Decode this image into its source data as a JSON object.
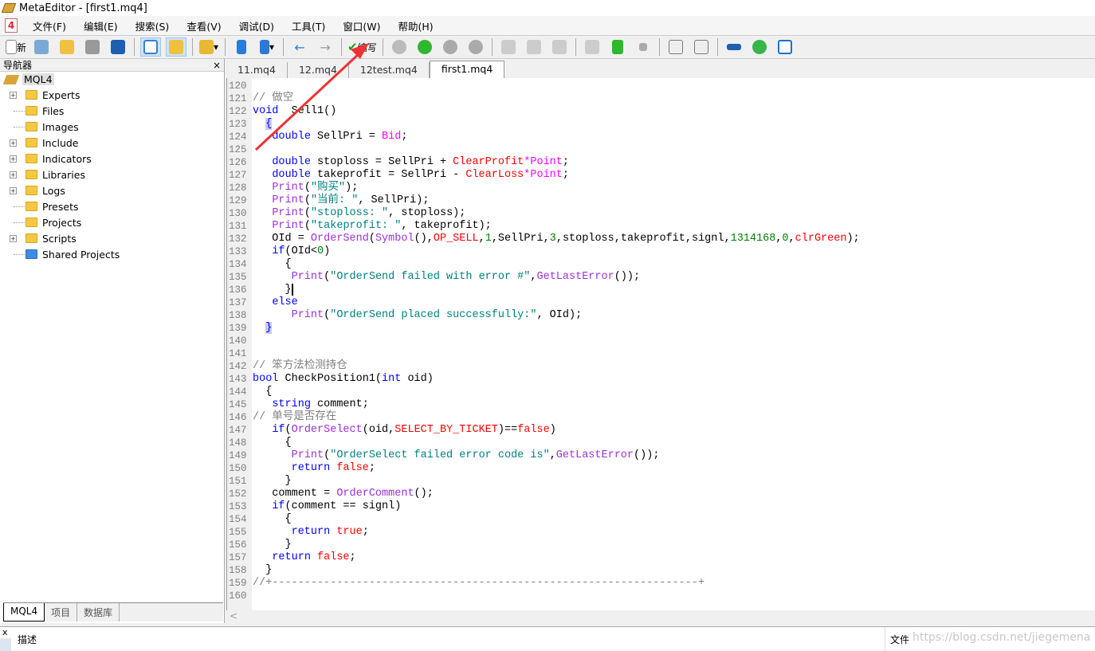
{
  "window": {
    "title": "MetaEditor - [first1.mq4]"
  },
  "menu": {
    "app_icon": "4",
    "items": [
      "文件(F)",
      "编辑(E)",
      "搜索(S)",
      "查看(V)",
      "调试(D)",
      "工具(T)",
      "窗口(W)",
      "帮助(H)"
    ]
  },
  "toolbar": {
    "new_label": "新",
    "compile_label": "编写"
  },
  "navigator": {
    "title": "导航器",
    "close": "×",
    "root": "MQL4",
    "items": [
      {
        "label": "Experts",
        "exp": true,
        "blue": false
      },
      {
        "label": "Files",
        "exp": false,
        "blue": false
      },
      {
        "label": "Images",
        "exp": false,
        "blue": false
      },
      {
        "label": "Include",
        "exp": true,
        "blue": false
      },
      {
        "label": "Indicators",
        "exp": true,
        "blue": false
      },
      {
        "label": "Libraries",
        "exp": true,
        "blue": false
      },
      {
        "label": "Logs",
        "exp": true,
        "blue": false
      },
      {
        "label": "Presets",
        "exp": false,
        "blue": false
      },
      {
        "label": "Projects",
        "exp": false,
        "blue": false
      },
      {
        "label": "Scripts",
        "exp": true,
        "blue": false
      },
      {
        "label": "Shared Projects",
        "exp": false,
        "blue": true
      }
    ],
    "bottom_tabs": [
      "MQL4",
      "项目",
      "数据库"
    ]
  },
  "editor": {
    "tabs": [
      "11.mq4",
      "12.mq4",
      "12test.mq4",
      "first1.mq4"
    ],
    "active_tab": 3,
    "scroll_left": "<",
    "lines": [
      {
        "n": "120",
        "t": []
      },
      {
        "n": "121",
        "t": [
          [
            "c",
            "// 做空"
          ]
        ]
      },
      {
        "n": "122",
        "t": [
          [
            "k",
            "void"
          ],
          [
            "",
            "  Sell1()"
          ]
        ]
      },
      {
        "n": "123",
        "t": [
          [
            "",
            "  "
          ],
          [
            "b",
            "{"
          ]
        ]
      },
      {
        "n": "124",
        "t": [
          [
            "",
            "   "
          ],
          [
            "k",
            "double"
          ],
          [
            "",
            " SellPri = "
          ],
          [
            "m",
            "Bid"
          ],
          [
            "",
            ";"
          ]
        ]
      },
      {
        "n": "125",
        "t": []
      },
      {
        "n": "126",
        "t": [
          [
            "",
            "   "
          ],
          [
            "k",
            "double"
          ],
          [
            "",
            " stoploss = SellPri + "
          ],
          [
            "r",
            "ClearProfit"
          ],
          [
            "m",
            "*Point"
          ],
          [
            "",
            ";"
          ]
        ]
      },
      {
        "n": "127",
        "t": [
          [
            "",
            "   "
          ],
          [
            "k",
            "double"
          ],
          [
            "",
            " takeprofit = SellPri - "
          ],
          [
            "r",
            "ClearLoss"
          ],
          [
            "m",
            "*Point"
          ],
          [
            "",
            ";"
          ]
        ]
      },
      {
        "n": "128",
        "t": [
          [
            "",
            "   "
          ],
          [
            "f",
            "Print"
          ],
          [
            "",
            "("
          ],
          [
            "s",
            "\"购买\""
          ],
          [
            "",
            ");"
          ]
        ]
      },
      {
        "n": "129",
        "t": [
          [
            "",
            "   "
          ],
          [
            "f",
            "Print"
          ],
          [
            "",
            "("
          ],
          [
            "s",
            "\"当前: \""
          ],
          [
            "",
            ", SellPri);"
          ]
        ]
      },
      {
        "n": "130",
        "t": [
          [
            "",
            "   "
          ],
          [
            "f",
            "Print"
          ],
          [
            "",
            "("
          ],
          [
            "s",
            "\"stoploss: \""
          ],
          [
            "",
            ", stoploss);"
          ]
        ]
      },
      {
        "n": "131",
        "t": [
          [
            "",
            "   "
          ],
          [
            "f",
            "Print"
          ],
          [
            "",
            "("
          ],
          [
            "s",
            "\"takeprofit: \""
          ],
          [
            "",
            ", takeprofit);"
          ]
        ]
      },
      {
        "n": "132",
        "t": [
          [
            "",
            "   OId = "
          ],
          [
            "f",
            "OrderSend"
          ],
          [
            "",
            "("
          ],
          [
            "f",
            "Symbol"
          ],
          [
            "",
            "(),"
          ],
          [
            "r",
            "OP_SELL"
          ],
          [
            "",
            ","
          ],
          [
            "n",
            "1"
          ],
          [
            "",
            ",SellPri,"
          ],
          [
            "n",
            "3"
          ],
          [
            "",
            ",stoploss,takeprofit,signl,"
          ],
          [
            "n",
            "1314168"
          ],
          [
            "",
            ","
          ],
          [
            "n",
            "0"
          ],
          [
            "",
            ","
          ],
          [
            "r",
            "clrGreen"
          ],
          [
            "",
            ");"
          ]
        ]
      },
      {
        "n": "133",
        "t": [
          [
            "",
            "   "
          ],
          [
            "k",
            "if"
          ],
          [
            "",
            "(OId<"
          ],
          [
            "n",
            "0"
          ],
          [
            "",
            ")"
          ]
        ]
      },
      {
        "n": "134",
        "t": [
          [
            "",
            "     {"
          ]
        ]
      },
      {
        "n": "135",
        "t": [
          [
            "",
            "      "
          ],
          [
            "f",
            "Print"
          ],
          [
            "",
            "("
          ],
          [
            "s",
            "\"OrderSend failed with error #\""
          ],
          [
            "",
            ","
          ],
          [
            "f",
            "GetLastError"
          ],
          [
            "",
            "());"
          ]
        ]
      },
      {
        "n": "136",
        "t": [
          [
            "",
            "     "
          ],
          [
            "cur",
            "}"
          ]
        ]
      },
      {
        "n": "137",
        "t": [
          [
            "",
            "   "
          ],
          [
            "k",
            "else"
          ]
        ]
      },
      {
        "n": "138",
        "t": [
          [
            "",
            "      "
          ],
          [
            "f",
            "Print"
          ],
          [
            "",
            "("
          ],
          [
            "s",
            "\"OrderSend placed successfully:\""
          ],
          [
            "",
            ", OId);"
          ]
        ]
      },
      {
        "n": "139",
        "t": [
          [
            "",
            "  "
          ],
          [
            "b",
            "}"
          ]
        ]
      },
      {
        "n": "140",
        "t": []
      },
      {
        "n": "141",
        "t": []
      },
      {
        "n": "142",
        "t": [
          [
            "c",
            "// 笨方法检测持仓"
          ]
        ]
      },
      {
        "n": "143",
        "t": [
          [
            "k",
            "bool"
          ],
          [
            "",
            " CheckPosition1("
          ],
          [
            "k",
            "int"
          ],
          [
            "",
            " oid)"
          ]
        ]
      },
      {
        "n": "144",
        "t": [
          [
            "",
            "  {"
          ]
        ]
      },
      {
        "n": "145",
        "t": [
          [
            "",
            "   "
          ],
          [
            "k",
            "string"
          ],
          [
            "",
            " comment;"
          ]
        ]
      },
      {
        "n": "146",
        "t": [
          [
            "c",
            "// 单号是否存在"
          ]
        ]
      },
      {
        "n": "147",
        "t": [
          [
            "",
            "   "
          ],
          [
            "k",
            "if"
          ],
          [
            "",
            "("
          ],
          [
            "f",
            "OrderSelect"
          ],
          [
            "",
            "(oid,"
          ],
          [
            "r",
            "SELECT_BY_TICKET"
          ],
          [
            "",
            ")=="
          ],
          [
            "r",
            "false"
          ],
          [
            "",
            ")"
          ]
        ]
      },
      {
        "n": "148",
        "t": [
          [
            "",
            "     {"
          ]
        ]
      },
      {
        "n": "149",
        "t": [
          [
            "",
            "      "
          ],
          [
            "f",
            "Print"
          ],
          [
            "",
            "("
          ],
          [
            "s",
            "\"OrderSelect failed error code is\""
          ],
          [
            "",
            ","
          ],
          [
            "f",
            "GetLastError"
          ],
          [
            "",
            "());"
          ]
        ]
      },
      {
        "n": "150",
        "t": [
          [
            "",
            "      "
          ],
          [
            "k",
            "return"
          ],
          [
            "",
            " "
          ],
          [
            "r",
            "false"
          ],
          [
            "",
            ";"
          ]
        ]
      },
      {
        "n": "151",
        "t": [
          [
            "",
            "     }"
          ]
        ]
      },
      {
        "n": "152",
        "t": [
          [
            "",
            "   comment = "
          ],
          [
            "f",
            "OrderComment"
          ],
          [
            "",
            "();"
          ]
        ]
      },
      {
        "n": "153",
        "t": [
          [
            "",
            "   "
          ],
          [
            "k",
            "if"
          ],
          [
            "",
            "(comment == signl)"
          ]
        ]
      },
      {
        "n": "154",
        "t": [
          [
            "",
            "     {"
          ]
        ]
      },
      {
        "n": "155",
        "t": [
          [
            "",
            "      "
          ],
          [
            "k",
            "return"
          ],
          [
            "",
            " "
          ],
          [
            "r",
            "true"
          ],
          [
            "",
            ";"
          ]
        ]
      },
      {
        "n": "156",
        "t": [
          [
            "",
            "     }"
          ]
        ]
      },
      {
        "n": "157",
        "t": [
          [
            "",
            "   "
          ],
          [
            "k",
            "return"
          ],
          [
            "",
            " "
          ],
          [
            "r",
            "false"
          ],
          [
            "",
            ";"
          ]
        ]
      },
      {
        "n": "158",
        "t": [
          [
            "",
            "  }"
          ]
        ]
      },
      {
        "n": "159",
        "t": [
          [
            "c",
            "//+------------------------------------------------------------------+"
          ]
        ]
      },
      {
        "n": "160",
        "t": []
      }
    ]
  },
  "bottom_panel": {
    "close": "x",
    "description_header": "描述",
    "file_header": "文件",
    "watermark": "https://blog.csdn.net/jiegemena"
  },
  "colors": {
    "keyword": "#0000ff",
    "function": "#9c30d8",
    "string": "#008080",
    "constant": "#ff0000",
    "number": "#008000",
    "comment": "#808080",
    "annotation_arrow": "#ee3333"
  }
}
